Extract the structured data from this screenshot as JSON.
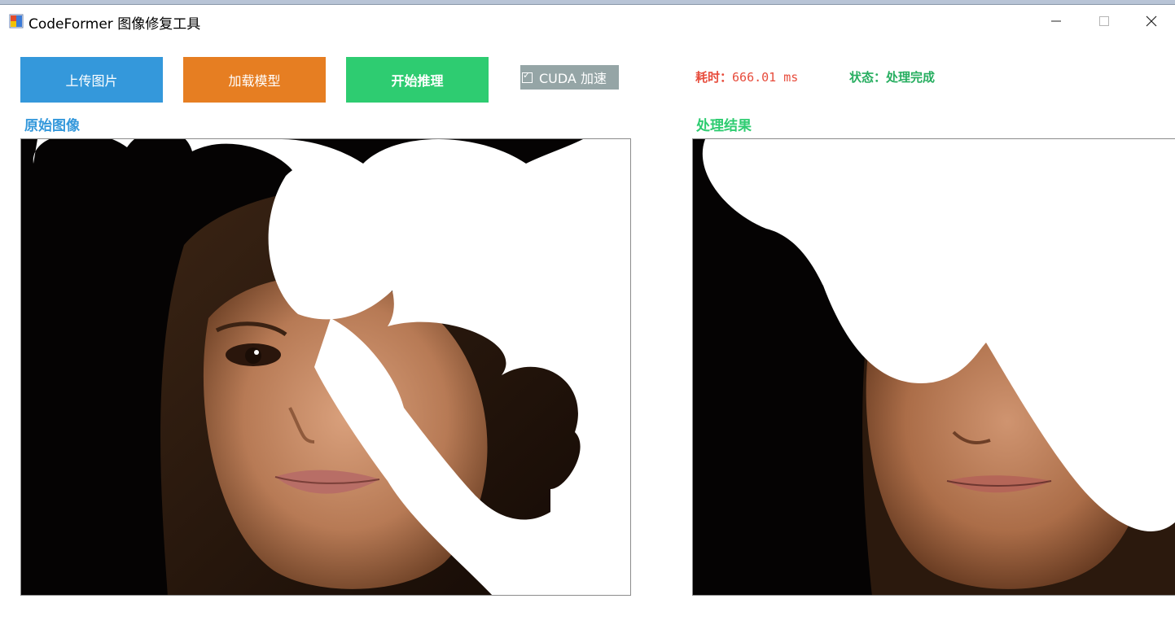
{
  "window": {
    "title": "CodeFormer 图像修复工具",
    "controls": {
      "minimize": "–",
      "maximize": "□",
      "close": "✕"
    }
  },
  "toolbar": {
    "upload_label": "上传图片",
    "load_model_label": "加载模型",
    "infer_label": "开始推理",
    "cuda_label": "CUDA 加速",
    "cuda_checked": true
  },
  "stats": {
    "time_label": "耗时：",
    "time_value": "666.01 ms",
    "status_text": "状态：处理完成"
  },
  "panels": {
    "original_title": "原始图像",
    "result_title": "处理结果"
  },
  "colors": {
    "upload": "#3498db",
    "load_model": "#e67e22",
    "infer": "#2ecc71",
    "cuda_bg": "#95a5a6",
    "time_text": "#e74c3c",
    "status_text": "#27ae60"
  }
}
